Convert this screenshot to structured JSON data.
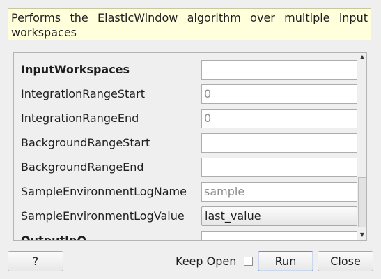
{
  "description": "Performs the ElasticWindow algorithm over multiple input workspaces",
  "properties": [
    {
      "label": "InputWorkspaces",
      "value": "",
      "placeholder": "",
      "bold": true
    },
    {
      "label": "IntegrationRangeStart",
      "value": "",
      "placeholder": "0",
      "bold": false
    },
    {
      "label": "IntegrationRangeEnd",
      "value": "",
      "placeholder": "0",
      "bold": false
    },
    {
      "label": "BackgroundRangeStart",
      "value": "",
      "placeholder": "",
      "bold": false
    },
    {
      "label": "BackgroundRangeEnd",
      "value": "",
      "placeholder": "",
      "bold": false
    },
    {
      "label": "SampleEnvironmentLogName",
      "value": "",
      "placeholder": "sample",
      "bold": false
    },
    {
      "label": "SampleEnvironmentLogValue",
      "value": "last_value",
      "placeholder": "",
      "bold": false
    },
    {
      "label": "OutputInQ",
      "value": "",
      "placeholder": "",
      "bold": true
    }
  ],
  "scrollbar": {
    "up_icon": "arrow-up-icon",
    "down_icon": "arrow-down-icon"
  },
  "footer": {
    "help_label": "?",
    "keep_open_label": "Keep Open",
    "keep_open_checked": false,
    "run_label": "Run",
    "close_label": "Close"
  }
}
